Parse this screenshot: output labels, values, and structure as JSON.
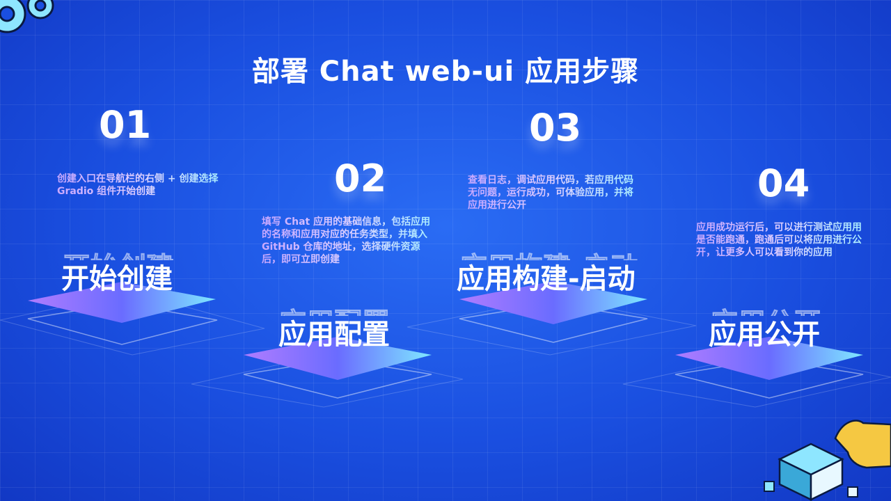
{
  "title": "部署 Chat web-ui 应用步骤",
  "steps": [
    {
      "num": "01",
      "label": "开始创建",
      "desc": "创建入口在导航栏的右侧 + 创建选择 Gradio 组件开始创建"
    },
    {
      "num": "02",
      "label": "应用配置",
      "desc": "填写 Chat 应用的基础信息，包括应用的名称和应用对应的任务类型，并填入 GitHub 仓库的地址，选择硬件资源后，即可立即创建"
    },
    {
      "num": "03",
      "label": "应用构建-启动",
      "desc": "查看日志，调试应用代码，若应用代码无问题，运行成功，可体验应用，并将应用进行公开"
    },
    {
      "num": "04",
      "label": "应用公开",
      "desc": "应用成功运行后，可以进行测试应用用是否能跑通，跑通后可以将应用进行公开，让更多人可以看到你的应用"
    }
  ],
  "colors": {
    "bg": "#1a4fe0",
    "platform_left": "#b07cff",
    "platform_right": "#7fe8ff"
  },
  "decor": {
    "top_left": "gear-cluster-icon",
    "bottom_right": "hand-cube-icon"
  }
}
